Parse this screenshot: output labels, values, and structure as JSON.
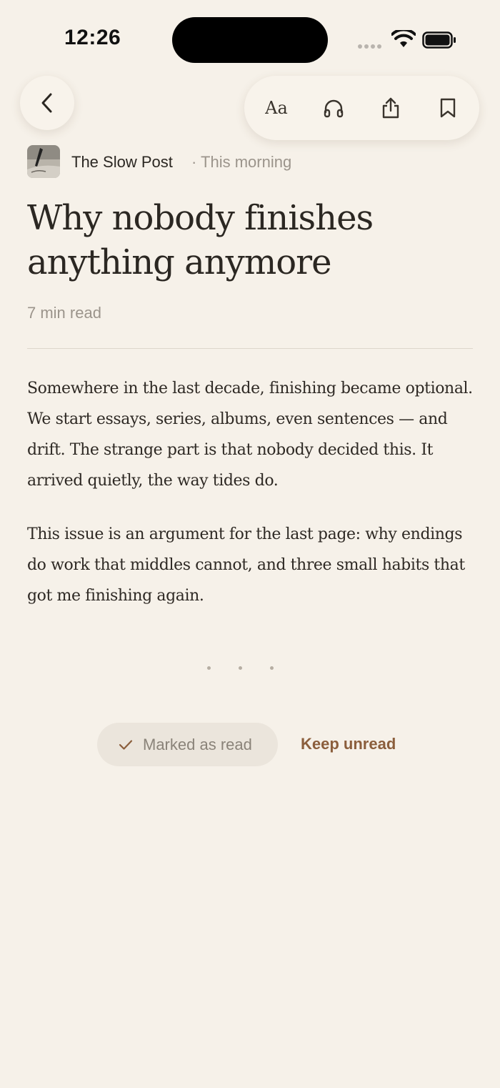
{
  "status_bar": {
    "time": "12:26",
    "icons": [
      "signal-dots-icon",
      "wifi-icon",
      "battery-icon"
    ]
  },
  "toolbar": {
    "back_icon": "chevron-left-icon",
    "text_size_label": "Aa",
    "listen_icon": "headphones-icon",
    "share_icon": "share-icon",
    "bookmark_icon": "bookmark-icon"
  },
  "byline": {
    "publication": "The Slow Post",
    "published": "· This morning",
    "avatar": "publication-logo"
  },
  "article": {
    "title": "Why nobody finishes anything anymore",
    "read_time": "7 min read",
    "paragraphs": [
      "Somewhere in the last decade, finishing became optional. We start essays, series, albums, even sentences — and drift. The strange part is that nobody decided this. It arrived quietly, the way tides do.",
      "This issue is an argument for the last page: why endings do work that middles cannot, and three small habits that got me finishing again."
    ]
  },
  "actions": {
    "marked_read_label": "Marked as read",
    "check_icon": "checkmark-icon",
    "keep_unread_label": "Keep unread"
  },
  "colors": {
    "background": "#f6f1e9",
    "text": "#2b2722",
    "muted": "#9b948b",
    "accent": "#8b5e3c"
  }
}
